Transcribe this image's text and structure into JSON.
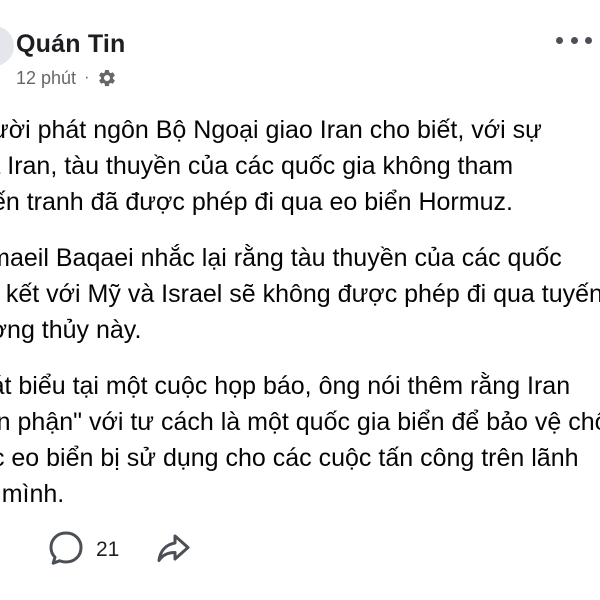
{
  "post": {
    "author": "Quán Tin",
    "time": "12 phút",
    "separator": "·",
    "privacy_icon": "gear-icon",
    "more_icon": "more-dots-icon",
    "paragraphs": [
      {
        "lines": [
          "Người phát ngôn Bộ Ngoại giao Iran cho biết, với sự",
          "của Iran, tàu thuyền của các quốc gia không tham",
          "chiến tranh đã được phép đi qua eo biển Hormuz."
        ]
      },
      {
        "lines": [
          "Esmaeil Baqaei nhắc lại rằng tàu thuyền của các quốc",
          "liên kết với Mỹ và Israel sẽ không được phép đi qua tuyến",
          "đường thủy này."
        ]
      },
      {
        "lines": [
          "Phát biểu tại một cuộc họp báo, ông nói thêm rằng Iran",
          "\"bổn phận\" với tư cách là một quốc gia biển để bảo vệ chống",
          "việc eo biển bị sử dụng cho các cuộc tấn công trên lãnh",
          "thổ mình."
        ]
      }
    ]
  },
  "actions": {
    "comment_icon": "comment-icon",
    "comment_count": "21",
    "share_icon": "share-icon"
  },
  "colors": {
    "text": "#050505",
    "secondary": "#65676b",
    "icon": "#4b4f56"
  }
}
